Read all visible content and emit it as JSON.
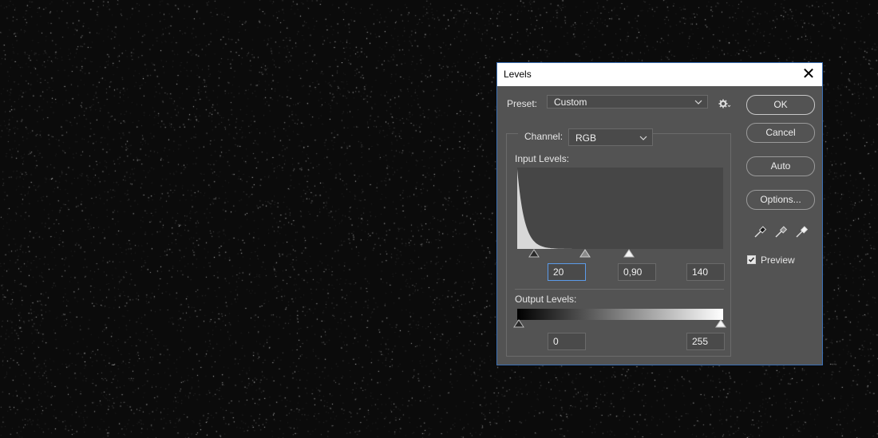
{
  "dialog": {
    "title": "Levels",
    "close_glyph": "✕",
    "preset": {
      "label": "Preset:",
      "value": "Custom"
    },
    "channel": {
      "label": "Channel:",
      "value": "RGB"
    },
    "input_levels": {
      "label": "Input Levels:",
      "black": "20",
      "gamma": "0,90",
      "white": "140"
    },
    "output_levels": {
      "label": "Output Levels:",
      "black": "0",
      "white": "255"
    },
    "buttons": {
      "ok": "OK",
      "cancel": "Cancel",
      "auto": "Auto",
      "options": "Options..."
    },
    "preview": {
      "label": "Preview",
      "checked": true
    }
  },
  "icons": {
    "gear": "gear-menu-icon",
    "eyedroppers": [
      "black-point-eyedropper-icon",
      "gray-point-eyedropper-icon",
      "white-point-eyedropper-icon"
    ]
  },
  "colors": {
    "dialog_bg": "#535353",
    "title_bg": "#ffffff",
    "accent_border": "#3a6fb5",
    "focus_border": "#5b9bea",
    "canvas_bg": "#0b0b0b"
  }
}
